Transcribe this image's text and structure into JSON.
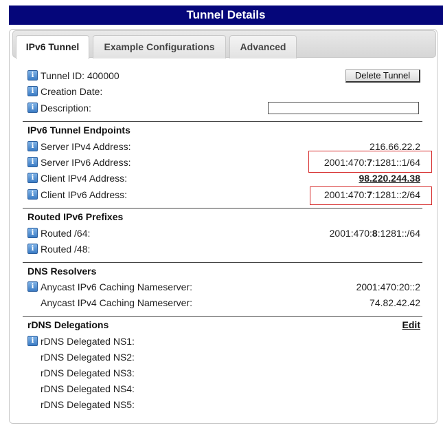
{
  "title": "Tunnel Details",
  "tabs": [
    {
      "label": "IPv6 Tunnel"
    },
    {
      "label": "Example Configurations"
    },
    {
      "label": "Advanced"
    }
  ],
  "general": {
    "tunnel_id": "Tunnel ID: 400000",
    "creation_date": "Creation Date:",
    "description": "Description:",
    "delete_button": "Delete Tunnel",
    "description_value": ""
  },
  "endpoints": {
    "heading": "IPv6 Tunnel Endpoints",
    "server_ipv4_label": "Server IPv4 Address:",
    "server_ipv4_value": "216.66.22.2",
    "server_ipv6_label": "Server IPv6 Address:",
    "server_ipv6_pre": "2001:470:",
    "server_ipv6_bold": "7",
    "server_ipv6_post": ":1281::1/64",
    "client_ipv4_label": "Client IPv4 Address:",
    "client_ipv4_value": "98.220.244.38",
    "client_ipv6_label": "Client IPv6 Address:",
    "client_ipv6_pre": "2001:470:",
    "client_ipv6_bold": "7",
    "client_ipv6_post": ":1281::2/64"
  },
  "prefixes": {
    "heading": "Routed IPv6 Prefixes",
    "r64_label": "Routed /64:",
    "r64_pre": "2001:470:",
    "r64_bold": "8",
    "r64_post": ":1281::/64",
    "r48_label": "Routed /48:"
  },
  "dns": {
    "heading": "DNS Resolvers",
    "ipv6_label": "Anycast IPv6 Caching Nameserver:",
    "ipv6_value": "2001:470:20::2",
    "ipv4_label": "Anycast IPv4 Caching Nameserver:",
    "ipv4_value": "74.82.42.42"
  },
  "rdns": {
    "heading": "rDNS Delegations",
    "edit_label": "Edit",
    "ns1": "rDNS Delegated NS1:",
    "ns2": "rDNS Delegated NS2:",
    "ns3": "rDNS Delegated NS3:",
    "ns4": "rDNS Delegated NS4:",
    "ns5": "rDNS Delegated NS5:"
  },
  "icons": {
    "info": "info-icon",
    "info_glyph": "i"
  },
  "colors": {
    "title_bg": "#05067a",
    "highlight": "#d62b2b",
    "info_icon": "#3b7cc4"
  }
}
